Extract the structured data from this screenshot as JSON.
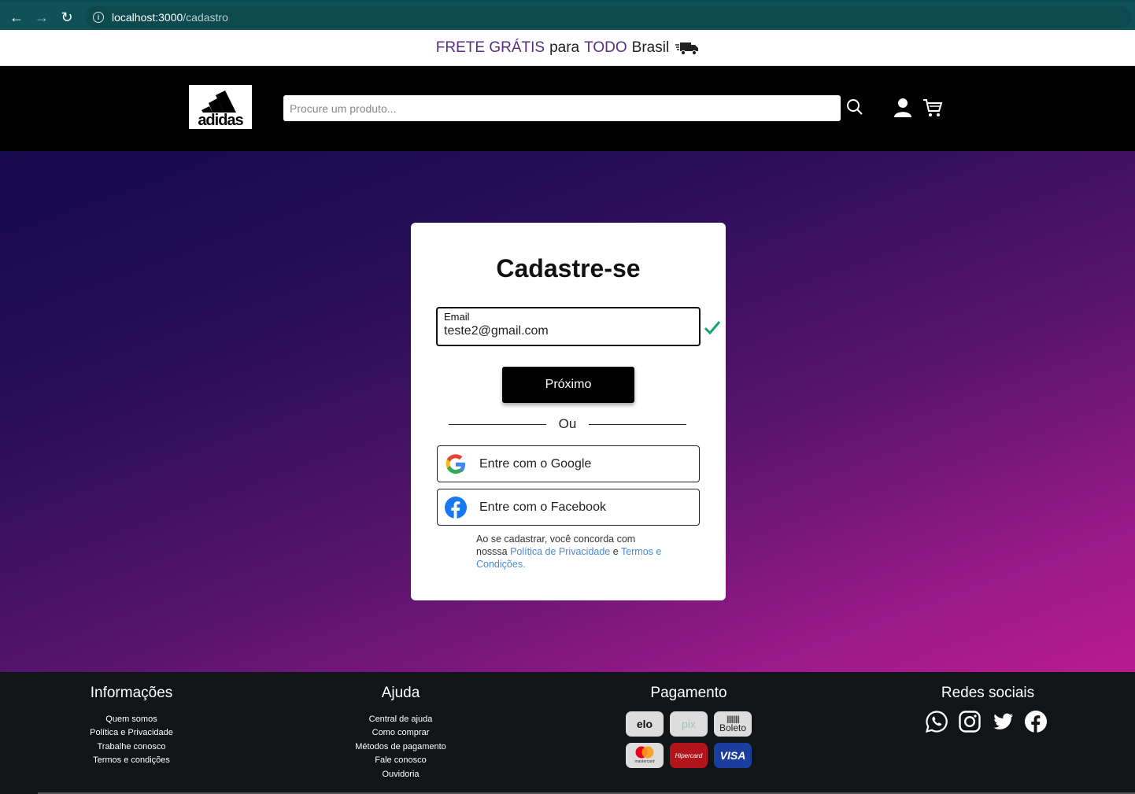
{
  "browser": {
    "url_host": "localhost:3000",
    "url_path": "/cadastro"
  },
  "promo": {
    "part1": "FRETE GRÁTIS",
    "part2": "para",
    "part3": "TODO",
    "part4": "Brasil"
  },
  "header": {
    "logo_text": "adidas",
    "search_placeholder": "Procure um produto..."
  },
  "card": {
    "title": "Cadastre-se",
    "email_label": "Email",
    "email_value": "teste2@gmail.com",
    "next_label": "Próximo",
    "or_label": "Ou",
    "google_label": "Entre com o Google",
    "facebook_label": "Entre com o Facebook",
    "terms_prefix": "Ao se cadastrar, você concorda com nosssa",
    "privacy_link": "Política de Privacidade",
    "terms_and": "e",
    "terms_link": "Termos e Condições",
    "terms_suffix": "."
  },
  "footer": {
    "info": {
      "title": "Informações",
      "links": [
        "Quem somos",
        "Política e Privacidade",
        "Trabalhe conosco",
        "Termos e condições"
      ]
    },
    "help": {
      "title": "Ajuda",
      "links": [
        "Central de ajuda",
        "Como comprar",
        "Métodos de pagamento",
        "Fale conosco",
        "Ouvidoria"
      ]
    },
    "payment": {
      "title": "Pagamento",
      "methods": [
        "elo",
        "pix",
        "Boleto",
        "mastercard",
        "Hipercard",
        "VISA"
      ]
    },
    "social": {
      "title": "Redes sociais",
      "icons": [
        "whatsapp-icon",
        "instagram-icon",
        "twitter-icon",
        "facebook-icon"
      ]
    }
  },
  "colors": {
    "browser_bar": "#0e5257",
    "promo_accent": "#5a2d82",
    "check_green": "#1aa36f",
    "link_blue": "#4a8ad4"
  }
}
